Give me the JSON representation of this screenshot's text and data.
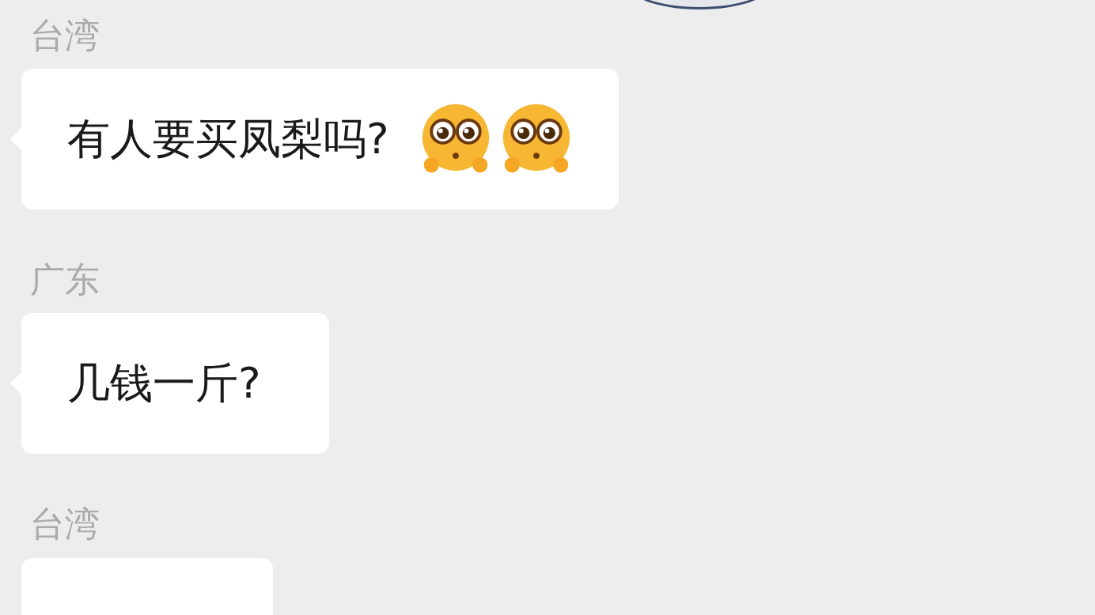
{
  "messages": [
    {
      "sender": "台湾",
      "text": "有人要买凤梨吗?",
      "emojis": [
        {
          "kind": "pleading"
        },
        {
          "kind": "pleading"
        }
      ]
    },
    {
      "sender": "广东",
      "text": "几钱一斤?"
    },
    {
      "sender": "台湾"
    }
  ]
}
